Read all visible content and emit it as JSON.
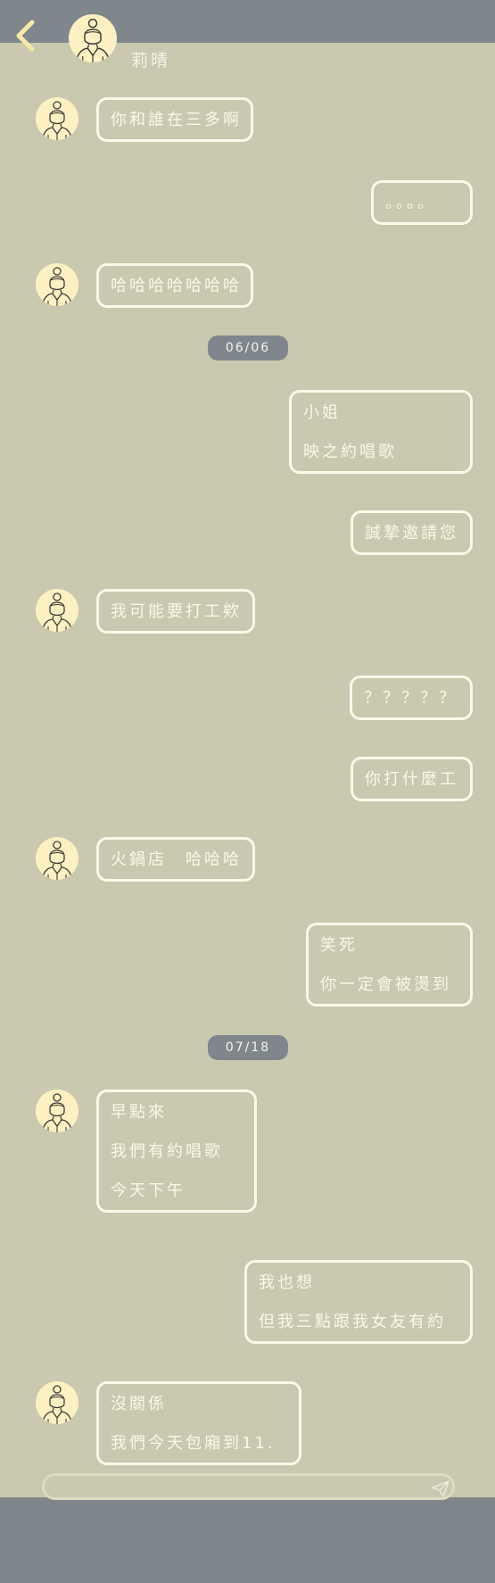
{
  "header": {
    "contact_name": "莉晴"
  },
  "messages": [
    {
      "from": "them",
      "lines": [
        "你和誰在三多啊"
      ]
    },
    {
      "from": "me",
      "lines": [
        "。。。。"
      ]
    },
    {
      "from": "them",
      "lines": [
        "哈哈哈哈哈哈哈"
      ]
    },
    {
      "type": "date",
      "label": "06/06"
    },
    {
      "from": "me",
      "lines": [
        "小姐",
        "映之約唱歌"
      ]
    },
    {
      "from": "me",
      "lines": [
        "誠摯邀請您"
      ]
    },
    {
      "from": "them",
      "lines": [
        "我可能要打工欸"
      ]
    },
    {
      "from": "me",
      "lines": [
        "？？？？？"
      ]
    },
    {
      "from": "me",
      "lines": [
        "你打什麼工"
      ]
    },
    {
      "from": "them",
      "lines": [
        "火鍋店　哈哈哈"
      ]
    },
    {
      "from": "me",
      "lines": [
        "笑死",
        "你一定會被燙到"
      ]
    },
    {
      "type": "date",
      "label": "07/18"
    },
    {
      "from": "them",
      "lines": [
        "早點來",
        "我們有約唱歌",
        "今天下午"
      ]
    },
    {
      "from": "me",
      "lines": [
        "我也想",
        "但我三點跟我女友有約"
      ]
    },
    {
      "from": "them",
      "lines": [
        "沒關係",
        "我們今天包廂到11."
      ]
    }
  ],
  "composer": {
    "value": "",
    "placeholder": ""
  },
  "colors": {
    "background": "#cac8ae",
    "bar": "#7f868c",
    "bubble_border": "#fbf8ea",
    "avatar_bg": "#fdf1c4",
    "back_arrow": "#f4eaa6"
  },
  "icons": {
    "back": "chevron-left-icon",
    "avatar": "woman-portrait-icon",
    "send": "paper-plane-icon"
  }
}
